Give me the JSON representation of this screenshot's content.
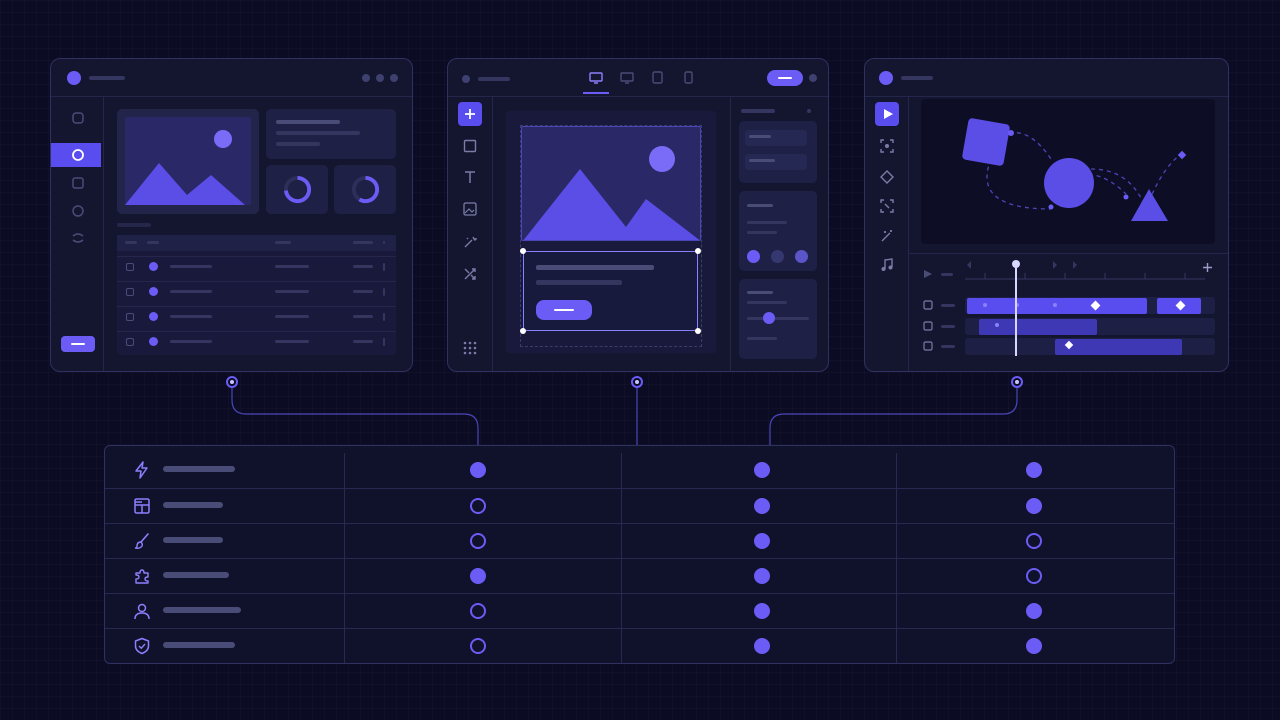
{
  "colors": {
    "background": "#0b0c24",
    "panel": "#14152f",
    "border": "#2f3160",
    "accent": "#6b5cf6",
    "accent_light": "#8b80ff",
    "muted": "#34365f"
  },
  "panels": [
    {
      "name": "dashboard-builder",
      "icons": [
        "hexagon-icon",
        "chart-pie-icon",
        "square-icon",
        "circle-icon",
        "layers-icon"
      ]
    },
    {
      "name": "page-designer",
      "device_icons": [
        "desktop-icon",
        "monitor-icon",
        "tablet-icon",
        "mobile-icon"
      ],
      "tool_icons": [
        "plus-icon",
        "square-icon",
        "text-icon",
        "image-icon",
        "magic-icon",
        "shuffle-icon",
        "grid-icon"
      ]
    },
    {
      "name": "motion-editor",
      "tool_icons": [
        "play-icon",
        "focus-icon",
        "diamond-icon",
        "select-icon",
        "wand-icon",
        "music-icon"
      ]
    }
  ],
  "features": [
    {
      "icon": "lightning-icon",
      "marks": [
        "full",
        "full",
        "full"
      ]
    },
    {
      "icon": "layout-icon",
      "marks": [
        "empty",
        "full",
        "full"
      ]
    },
    {
      "icon": "brush-icon",
      "marks": [
        "empty",
        "full",
        "empty"
      ]
    },
    {
      "icon": "puzzle-icon",
      "marks": [
        "full",
        "full",
        "empty"
      ]
    },
    {
      "icon": "user-icon",
      "marks": [
        "empty",
        "full",
        "full"
      ]
    },
    {
      "icon": "shield-icon",
      "marks": [
        "empty",
        "full",
        "full"
      ]
    }
  ]
}
